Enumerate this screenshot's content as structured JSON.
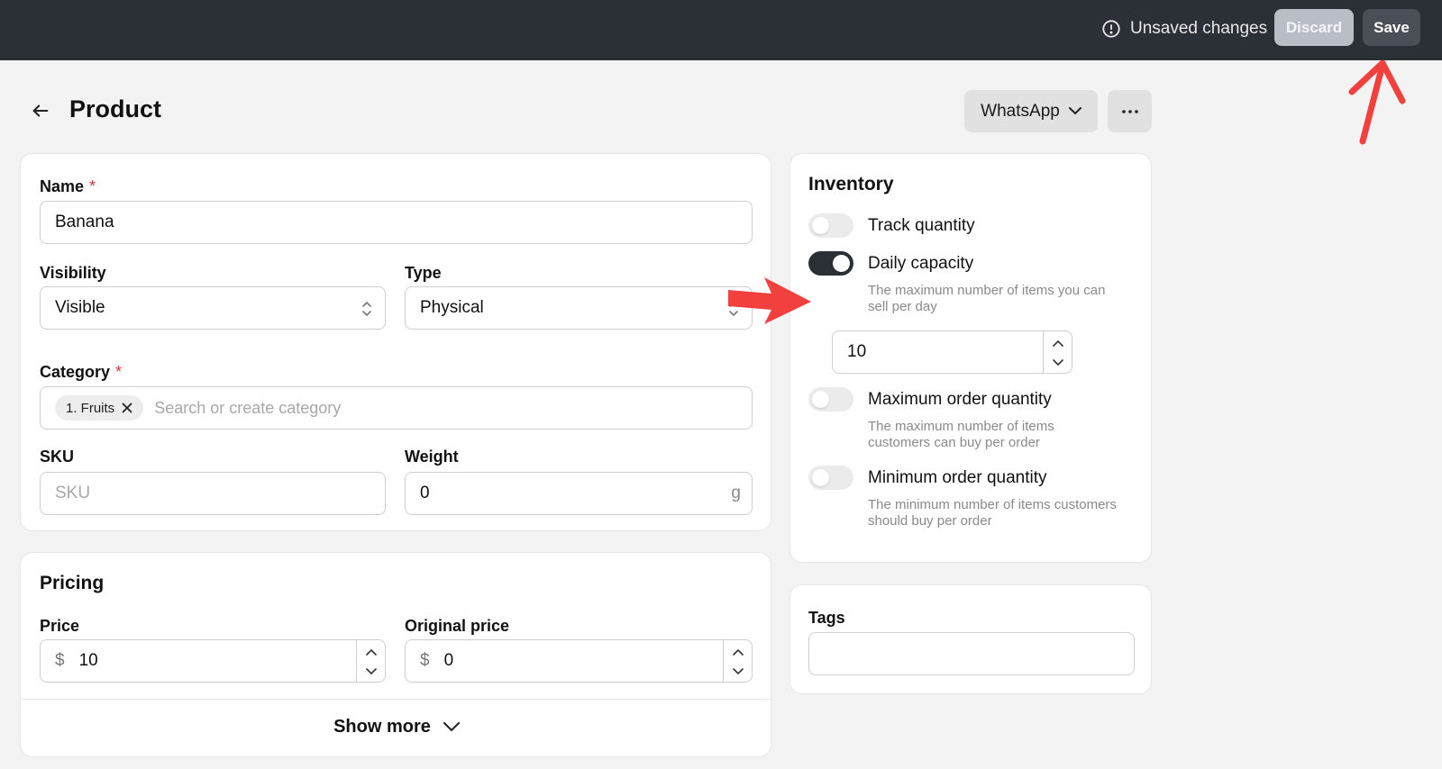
{
  "topbar": {
    "status_text": "Unsaved changes",
    "discard_label": "Discard",
    "save_label": "Save"
  },
  "header": {
    "title": "Product",
    "channel_label": "WhatsApp"
  },
  "general": {
    "name_label": "Name",
    "name_required": "*",
    "name_value": "Banana",
    "visibility_label": "Visibility",
    "visibility_value": "Visible",
    "type_label": "Type",
    "type_value": "Physical",
    "category_label": "Category",
    "category_required": "*",
    "category_chip": "1. Fruits",
    "category_placeholder": "Search or create category",
    "sku_label": "SKU",
    "sku_placeholder": "SKU",
    "weight_label": "Weight",
    "weight_value": "0",
    "weight_unit": "g"
  },
  "pricing": {
    "title": "Pricing",
    "price_label": "Price",
    "price_currency": "$",
    "price_value": "10",
    "original_price_label": "Original price",
    "original_currency": "$",
    "original_price_value": "0",
    "show_more_label": "Show more"
  },
  "inventory": {
    "title": "Inventory",
    "track_quantity": {
      "label": "Track quantity",
      "on": false
    },
    "daily_capacity": {
      "label": "Daily capacity",
      "on": true,
      "desc_line1": "The maximum number of items you can",
      "desc_line2": "sell per day",
      "value": "10"
    },
    "max_order": {
      "label": "Maximum order quantity",
      "on": false,
      "desc_line1": "The maximum number of items",
      "desc_line2": "customers can buy per order"
    },
    "min_order": {
      "label": "Minimum order quantity",
      "on": false,
      "desc_line1": "The minimum number of items customers",
      "desc_line2": "should buy per order"
    }
  },
  "tags": {
    "title": "Tags"
  },
  "colors": {
    "topbar": "#2b2f36",
    "annotation_arrow": "#f2403f",
    "required_star": "#dd3333"
  }
}
